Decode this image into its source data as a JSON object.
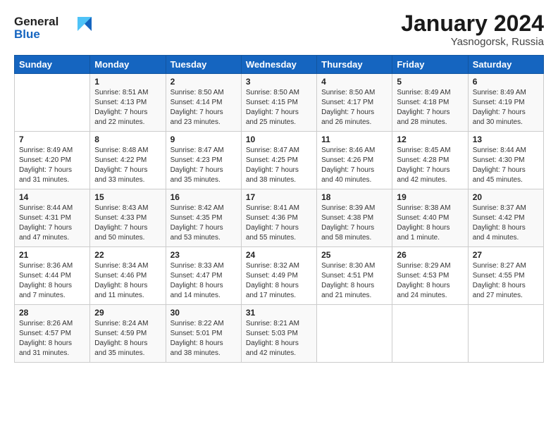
{
  "logo": {
    "line1": "General",
    "line2": "Blue"
  },
  "title": "January 2024",
  "location": "Yasnogorsk, Russia",
  "header": {
    "days": [
      "Sunday",
      "Monday",
      "Tuesday",
      "Wednesday",
      "Thursday",
      "Friday",
      "Saturday"
    ]
  },
  "weeks": [
    [
      {
        "day": "",
        "sunrise": "",
        "sunset": "",
        "daylight": ""
      },
      {
        "day": "1",
        "sunrise": "Sunrise: 8:51 AM",
        "sunset": "Sunset: 4:13 PM",
        "daylight": "Daylight: 7 hours and 22 minutes."
      },
      {
        "day": "2",
        "sunrise": "Sunrise: 8:50 AM",
        "sunset": "Sunset: 4:14 PM",
        "daylight": "Daylight: 7 hours and 23 minutes."
      },
      {
        "day": "3",
        "sunrise": "Sunrise: 8:50 AM",
        "sunset": "Sunset: 4:15 PM",
        "daylight": "Daylight: 7 hours and 25 minutes."
      },
      {
        "day": "4",
        "sunrise": "Sunrise: 8:50 AM",
        "sunset": "Sunset: 4:17 PM",
        "daylight": "Daylight: 7 hours and 26 minutes."
      },
      {
        "day": "5",
        "sunrise": "Sunrise: 8:49 AM",
        "sunset": "Sunset: 4:18 PM",
        "daylight": "Daylight: 7 hours and 28 minutes."
      },
      {
        "day": "6",
        "sunrise": "Sunrise: 8:49 AM",
        "sunset": "Sunset: 4:19 PM",
        "daylight": "Daylight: 7 hours and 30 minutes."
      }
    ],
    [
      {
        "day": "7",
        "sunrise": "Sunrise: 8:49 AM",
        "sunset": "Sunset: 4:20 PM",
        "daylight": "Daylight: 7 hours and 31 minutes."
      },
      {
        "day": "8",
        "sunrise": "Sunrise: 8:48 AM",
        "sunset": "Sunset: 4:22 PM",
        "daylight": "Daylight: 7 hours and 33 minutes."
      },
      {
        "day": "9",
        "sunrise": "Sunrise: 8:47 AM",
        "sunset": "Sunset: 4:23 PM",
        "daylight": "Daylight: 7 hours and 35 minutes."
      },
      {
        "day": "10",
        "sunrise": "Sunrise: 8:47 AM",
        "sunset": "Sunset: 4:25 PM",
        "daylight": "Daylight: 7 hours and 38 minutes."
      },
      {
        "day": "11",
        "sunrise": "Sunrise: 8:46 AM",
        "sunset": "Sunset: 4:26 PM",
        "daylight": "Daylight: 7 hours and 40 minutes."
      },
      {
        "day": "12",
        "sunrise": "Sunrise: 8:45 AM",
        "sunset": "Sunset: 4:28 PM",
        "daylight": "Daylight: 7 hours and 42 minutes."
      },
      {
        "day": "13",
        "sunrise": "Sunrise: 8:44 AM",
        "sunset": "Sunset: 4:30 PM",
        "daylight": "Daylight: 7 hours and 45 minutes."
      }
    ],
    [
      {
        "day": "14",
        "sunrise": "Sunrise: 8:44 AM",
        "sunset": "Sunset: 4:31 PM",
        "daylight": "Daylight: 7 hours and 47 minutes."
      },
      {
        "day": "15",
        "sunrise": "Sunrise: 8:43 AM",
        "sunset": "Sunset: 4:33 PM",
        "daylight": "Daylight: 7 hours and 50 minutes."
      },
      {
        "day": "16",
        "sunrise": "Sunrise: 8:42 AM",
        "sunset": "Sunset: 4:35 PM",
        "daylight": "Daylight: 7 hours and 53 minutes."
      },
      {
        "day": "17",
        "sunrise": "Sunrise: 8:41 AM",
        "sunset": "Sunset: 4:36 PM",
        "daylight": "Daylight: 7 hours and 55 minutes."
      },
      {
        "day": "18",
        "sunrise": "Sunrise: 8:39 AM",
        "sunset": "Sunset: 4:38 PM",
        "daylight": "Daylight: 7 hours and 58 minutes."
      },
      {
        "day": "19",
        "sunrise": "Sunrise: 8:38 AM",
        "sunset": "Sunset: 4:40 PM",
        "daylight": "Daylight: 8 hours and 1 minute."
      },
      {
        "day": "20",
        "sunrise": "Sunrise: 8:37 AM",
        "sunset": "Sunset: 4:42 PM",
        "daylight": "Daylight: 8 hours and 4 minutes."
      }
    ],
    [
      {
        "day": "21",
        "sunrise": "Sunrise: 8:36 AM",
        "sunset": "Sunset: 4:44 PM",
        "daylight": "Daylight: 8 hours and 7 minutes."
      },
      {
        "day": "22",
        "sunrise": "Sunrise: 8:34 AM",
        "sunset": "Sunset: 4:46 PM",
        "daylight": "Daylight: 8 hours and 11 minutes."
      },
      {
        "day": "23",
        "sunrise": "Sunrise: 8:33 AM",
        "sunset": "Sunset: 4:47 PM",
        "daylight": "Daylight: 8 hours and 14 minutes."
      },
      {
        "day": "24",
        "sunrise": "Sunrise: 8:32 AM",
        "sunset": "Sunset: 4:49 PM",
        "daylight": "Daylight: 8 hours and 17 minutes."
      },
      {
        "day": "25",
        "sunrise": "Sunrise: 8:30 AM",
        "sunset": "Sunset: 4:51 PM",
        "daylight": "Daylight: 8 hours and 21 minutes."
      },
      {
        "day": "26",
        "sunrise": "Sunrise: 8:29 AM",
        "sunset": "Sunset: 4:53 PM",
        "daylight": "Daylight: 8 hours and 24 minutes."
      },
      {
        "day": "27",
        "sunrise": "Sunrise: 8:27 AM",
        "sunset": "Sunset: 4:55 PM",
        "daylight": "Daylight: 8 hours and 27 minutes."
      }
    ],
    [
      {
        "day": "28",
        "sunrise": "Sunrise: 8:26 AM",
        "sunset": "Sunset: 4:57 PM",
        "daylight": "Daylight: 8 hours and 31 minutes."
      },
      {
        "day": "29",
        "sunrise": "Sunrise: 8:24 AM",
        "sunset": "Sunset: 4:59 PM",
        "daylight": "Daylight: 8 hours and 35 minutes."
      },
      {
        "day": "30",
        "sunrise": "Sunrise: 8:22 AM",
        "sunset": "Sunset: 5:01 PM",
        "daylight": "Daylight: 8 hours and 38 minutes."
      },
      {
        "day": "31",
        "sunrise": "Sunrise: 8:21 AM",
        "sunset": "Sunset: 5:03 PM",
        "daylight": "Daylight: 8 hours and 42 minutes."
      },
      {
        "day": "",
        "sunrise": "",
        "sunset": "",
        "daylight": ""
      },
      {
        "day": "",
        "sunrise": "",
        "sunset": "",
        "daylight": ""
      },
      {
        "day": "",
        "sunrise": "",
        "sunset": "",
        "daylight": ""
      }
    ]
  ]
}
